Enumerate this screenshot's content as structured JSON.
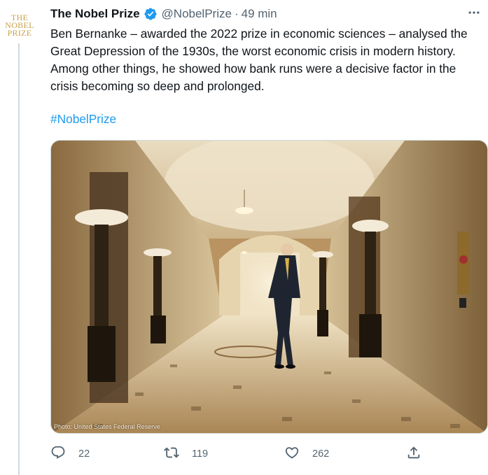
{
  "avatar": {
    "logo_lines": [
      "THE",
      "NOBEL",
      "PRIZE"
    ]
  },
  "tweet": {
    "author_name": "The Nobel Prize",
    "handle": "@NobelPrize",
    "separator": "·",
    "time": "49 min",
    "text": "Ben Bernanke – awarded the 2022 prize in economic sciences – analysed the Great Depression of the 1930s, the worst economic crisis in modern history. Among other things, he showed how bank runs were a decisive factor in the crisis becoming so deep and prolonged.",
    "hashtag": "#NobelPrize",
    "photo_credit": "Photo: United States Federal Reserve"
  },
  "actions": {
    "reply_count": "22",
    "retweet_count": "119",
    "like_count": "262"
  },
  "colors": {
    "link": "#1d9bf0",
    "secondary": "#536471",
    "verified": "#1d9bf0",
    "logo_gold": "#c9a24a"
  },
  "icons": [
    "verified-badge-icon",
    "more-icon",
    "reply-icon",
    "retweet-icon",
    "like-icon",
    "share-icon"
  ]
}
